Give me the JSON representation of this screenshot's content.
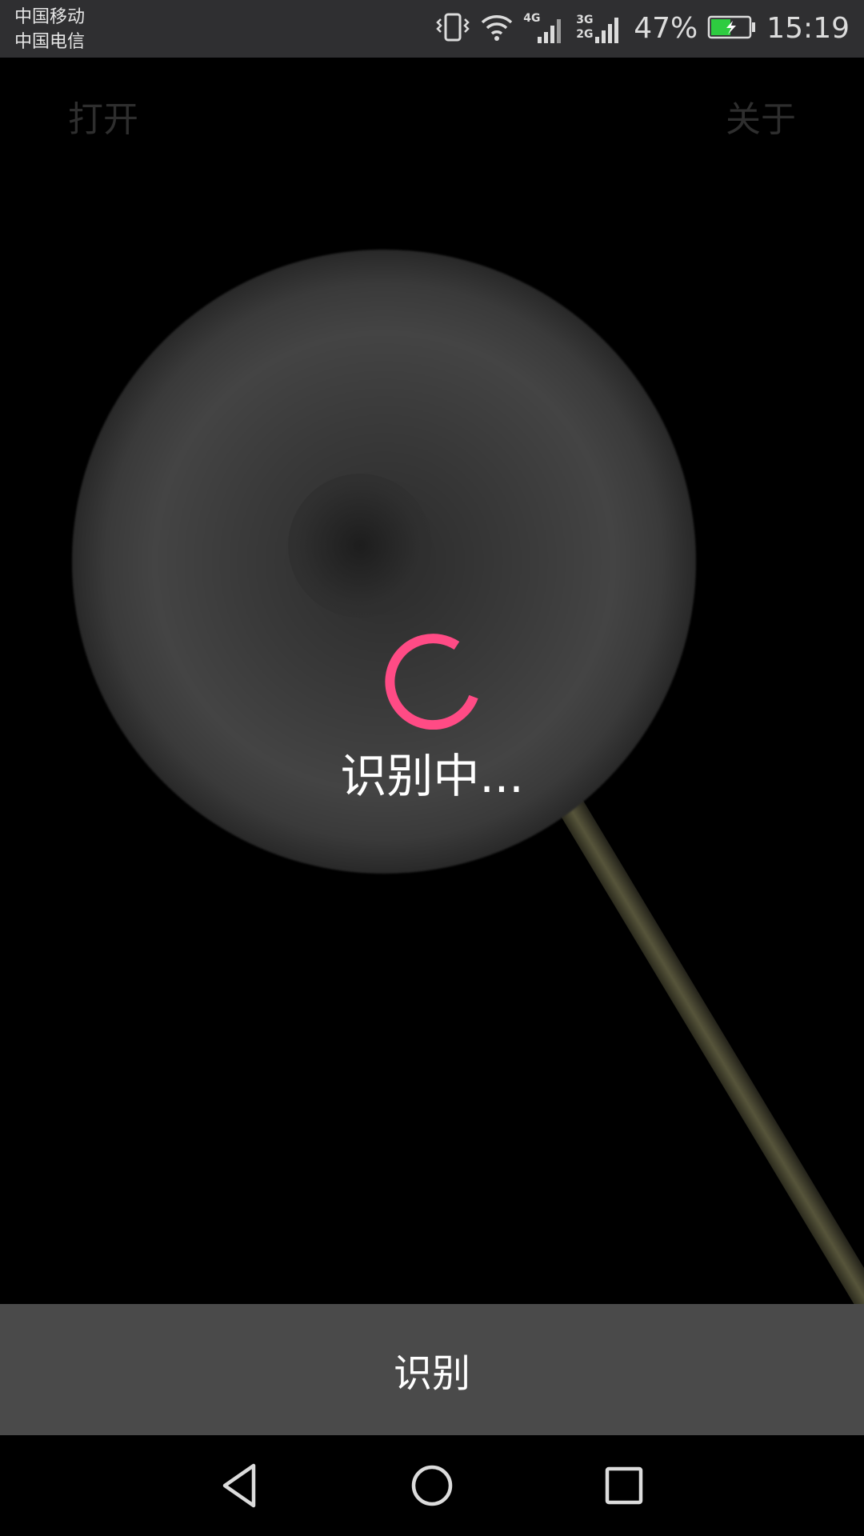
{
  "status_bar": {
    "carrier_1": "中国移动",
    "carrier_2": "中国电信",
    "network_1": "4G",
    "network_2": "3G",
    "network_3": "2G",
    "battery_percent": "47%",
    "time": "15:19",
    "icons": [
      "vibrate-icon",
      "wifi-icon",
      "signal-icon",
      "signal-icon",
      "battery-charging-icon"
    ],
    "battery_color": "#2ecc40"
  },
  "toolbar": {
    "open_label": "打开",
    "about_label": "关于"
  },
  "loading": {
    "text": "识别中...",
    "spinner_color": "#ff4b85"
  },
  "bottom": {
    "recognize_label": "识别"
  },
  "navbar": {
    "icons": [
      "back-icon",
      "home-icon",
      "recent-apps-icon"
    ]
  }
}
